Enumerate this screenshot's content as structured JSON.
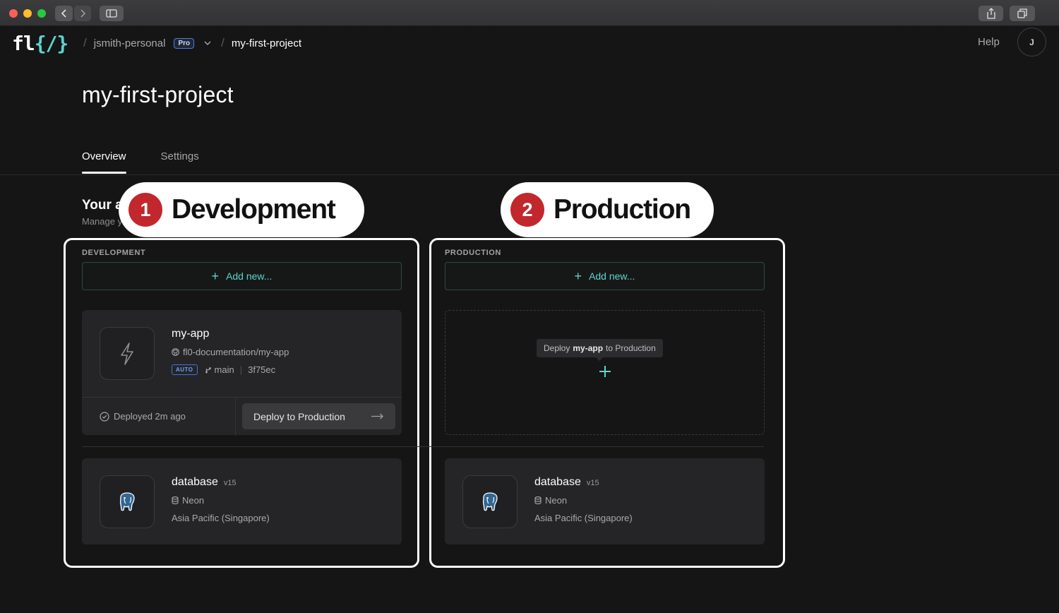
{
  "browser": {
    "back_icon": "chevron-left-icon",
    "forward_icon": "chevron-right-icon"
  },
  "header": {
    "logo": "fl{/}",
    "workspace": "jsmith-personal",
    "plan_badge": "Pro",
    "project": "my-first-project",
    "help": "Help",
    "avatar_initial": "J"
  },
  "page": {
    "title": "my-first-project"
  },
  "tabs": [
    {
      "label": "Overview",
      "active": true
    },
    {
      "label": "Settings",
      "active": false
    }
  ],
  "section": {
    "title": "Your a",
    "subtitle": "Manage y"
  },
  "callouts": [
    {
      "number": "1",
      "label": "Development"
    },
    {
      "number": "2",
      "label": "Production"
    }
  ],
  "development": {
    "label": "DEVELOPMENT",
    "add_new": "Add new...",
    "app": {
      "name": "my-app",
      "repo": "fl0-documentation/my-app",
      "badge": "AUTO",
      "branch": "main",
      "commit": "3f75ec",
      "status": "Deployed 2m ago",
      "deploy_button": "Deploy to Production"
    },
    "database": {
      "name": "database",
      "version": "v15",
      "provider": "Neon",
      "region": "Asia Pacific (Singapore)"
    }
  },
  "production": {
    "label": "PRODUCTION",
    "add_new": "Add new...",
    "tooltip": {
      "prefix": "Deploy",
      "app": "my-app",
      "suffix": "to Production"
    },
    "database": {
      "name": "database",
      "version": "v15",
      "provider": "Neon",
      "region": "Asia Pacific (Singapore)"
    }
  },
  "colors": {
    "accent": "#5fd3cc",
    "callout_red": "#c1272d",
    "background": "#151516",
    "card": "#252527"
  }
}
